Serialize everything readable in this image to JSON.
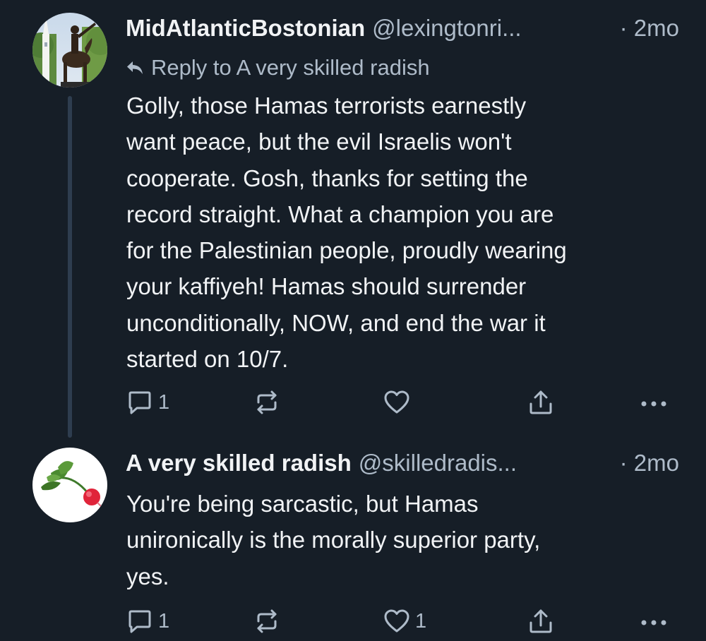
{
  "posts": [
    {
      "display_name": "MidAtlanticBostonian",
      "handle": "@lexingtonri...",
      "time": "· 2mo",
      "reply_to": "Reply to A very skilled radish",
      "body_lines": [
        "Golly, those Hamas terrorists earnestly",
        "want peace, but the evil Israelis won't",
        "cooperate. Gosh, thanks for setting the",
        "record straight. What a champion you are",
        "for the Palestinian people, proudly wearing",
        "your kaffiyeh! Hamas should surrender",
        "unconditionally, NOW, and end the war it",
        "started on 10/7."
      ],
      "avatar_icon": "statue-avatar",
      "reply_count": "1",
      "repost_count": "",
      "like_count": ""
    },
    {
      "display_name": "A very skilled radish",
      "handle": "@skilledradis...",
      "time": "· 2mo",
      "body_lines": [
        "You're being sarcastic, but Hamas",
        "unironically is the morally superior party,",
        "yes."
      ],
      "avatar_icon": "radish-avatar",
      "reply_count": "1",
      "repost_count": "",
      "like_count": "1"
    }
  ],
  "icons": {
    "reply": "comment-icon",
    "repost": "repost-icon",
    "like": "heart-icon",
    "share": "share-icon",
    "more": "more-dots-icon",
    "reply_to": "reply-arrow-icon"
  },
  "colors": {
    "background": "#161e27",
    "text": "#f1f3f5",
    "secondary_text": "#aebbc9",
    "thread_line": "#2e3d4f",
    "radish_red": "#e0243a"
  }
}
